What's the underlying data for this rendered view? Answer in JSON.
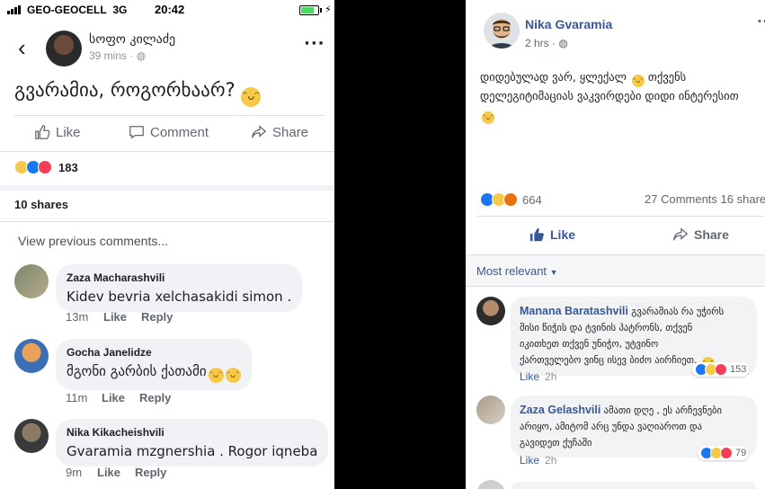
{
  "left": {
    "status": {
      "carrier": "GEO-GEOCELL",
      "network": "3G",
      "time": "20:42"
    },
    "post": {
      "author": "სოფო კილაძე",
      "time": "39 mins",
      "text": "გვარამია, როგორხაარ?",
      "actions": {
        "like": "Like",
        "comment": "Comment",
        "share": "Share"
      },
      "reaction_count": "183",
      "shares": "10 shares",
      "view_previous": "View previous comments..."
    },
    "comments": [
      {
        "name": "Zaza Macharashvili",
        "text": "Kidev bevria xelchasakidi simon .",
        "time": "13m",
        "like": "Like",
        "reply": "Reply"
      },
      {
        "name": "Gocha Janelidze",
        "text": "მგონი გარბის ქათამი",
        "time": "11m",
        "like": "Like",
        "reply": "Reply"
      },
      {
        "name": "Nika Kikacheishvili",
        "text": "Gvaramia mzgnershia . Rogor iqneba",
        "time": "9m",
        "like": "Like",
        "reply": "Reply"
      }
    ]
  },
  "right": {
    "post": {
      "author": "Nika Gvaramia",
      "time": "2 hrs",
      "line1": "დიდებულად ვარ, ყლექალ",
      "line1b": "თქვენს",
      "line2": "დელეგიტიმაციას ვაკვირდები დიდი ინტერესით",
      "reaction_count": "664",
      "comments_shares": "27 Comments  16 shares",
      "like": "Like",
      "share": "Share",
      "most_relevant": "Most relevant"
    },
    "comments": [
      {
        "name": "Manana Baratashvili",
        "text1": "გვარამიას რა უჭირს",
        "text2": "მისი წიჭის და ტვინის პატრონს, თქვენ",
        "text3": "იკითხეთ თქვენ უნიჭო, უტვინო",
        "text4": "ქართველებო ვინც ისევ ბიძო აირჩიეთ.",
        "like": "Like",
        "time": "2h",
        "reactions": "153"
      },
      {
        "name": "Zaza Gelashvili",
        "text1": "ამათი დღე , ეს არჩევნები",
        "text2": "არიყო, ამიტომ არც უნდა ვაღიაროთ და",
        "text3": "გავიდეთ ქუჩაში",
        "like": "Like",
        "time": "2h",
        "reactions": "79"
      }
    ]
  },
  "icons": [
    "signal-icon",
    "battery-icon",
    "back-icon",
    "more-icon",
    "globe-icon",
    "like-icon",
    "comment-icon",
    "share-icon",
    "haha-reaction-icon",
    "like-reaction-icon",
    "love-reaction-icon",
    "wow-reaction-icon",
    "angry-reaction-icon",
    "smile-emoji-icon",
    "caret-down-icon"
  ]
}
